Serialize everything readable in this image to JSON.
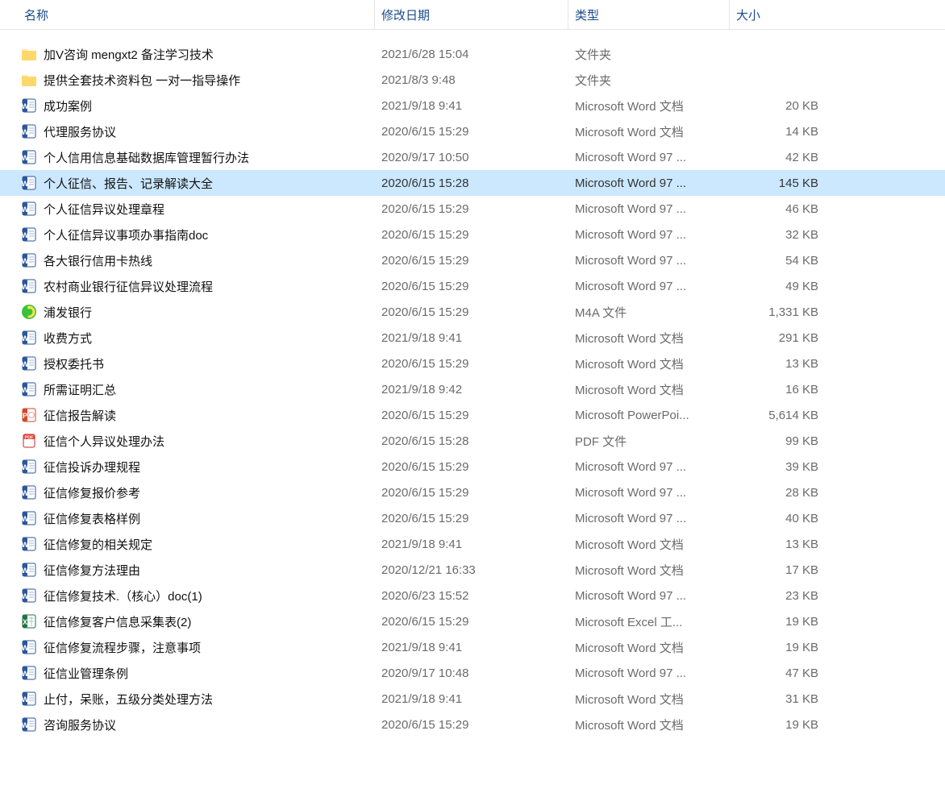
{
  "columns": {
    "name": "名称",
    "date": "修改日期",
    "type": "类型",
    "size": "大小"
  },
  "sort_indicator": "ˇ",
  "selected_index": 5,
  "files": [
    {
      "icon": "folder",
      "name": "加V咨询   mengxt2  备注学习技术",
      "date": "2021/6/28 15:04",
      "type": "文件夹",
      "size": ""
    },
    {
      "icon": "folder",
      "name": "提供全套技术资料包 一对一指导操作",
      "date": "2021/8/3 9:48",
      "type": "文件夹",
      "size": ""
    },
    {
      "icon": "word",
      "name": "成功案例",
      "date": "2021/9/18 9:41",
      "type": "Microsoft Word 文档",
      "size": "20 KB"
    },
    {
      "icon": "word",
      "name": "代理服务协议",
      "date": "2020/6/15 15:29",
      "type": "Microsoft Word 文档",
      "size": "14 KB"
    },
    {
      "icon": "word",
      "name": "个人信用信息基础数据库管理暂行办法",
      "date": "2020/9/17 10:50",
      "type": "Microsoft Word 97 ...",
      "size": "42 KB"
    },
    {
      "icon": "word",
      "name": "个人征信、报告、记录解读大全",
      "date": "2020/6/15 15:28",
      "type": "Microsoft Word 97 ...",
      "size": "145 KB"
    },
    {
      "icon": "word",
      "name": "个人征信异议处理章程",
      "date": "2020/6/15 15:29",
      "type": "Microsoft Word 97 ...",
      "size": "46 KB"
    },
    {
      "icon": "word",
      "name": "个人征信异议事项办事指南doc",
      "date": "2020/6/15 15:29",
      "type": "Microsoft Word 97 ...",
      "size": "32 KB"
    },
    {
      "icon": "word",
      "name": "各大银行信用卡热线",
      "date": "2020/6/15 15:29",
      "type": "Microsoft Word 97 ...",
      "size": "54 KB"
    },
    {
      "icon": "word",
      "name": "农村商业银行征信异议处理流程",
      "date": "2020/6/15 15:29",
      "type": "Microsoft Word 97 ...",
      "size": "49 KB"
    },
    {
      "icon": "audio",
      "name": "浦发银行",
      "date": "2020/6/15 15:29",
      "type": "M4A 文件",
      "size": "1,331 KB"
    },
    {
      "icon": "word",
      "name": "收费方式",
      "date": "2021/9/18 9:41",
      "type": "Microsoft Word 文档",
      "size": "291 KB"
    },
    {
      "icon": "word",
      "name": "授权委托书",
      "date": "2020/6/15 15:29",
      "type": "Microsoft Word 文档",
      "size": "13 KB"
    },
    {
      "icon": "word",
      "name": "所需证明汇总",
      "date": "2021/9/18 9:42",
      "type": "Microsoft Word 文档",
      "size": "16 KB"
    },
    {
      "icon": "ppt",
      "name": "征信报告解读",
      "date": "2020/6/15 15:29",
      "type": "Microsoft PowerPoi...",
      "size": "5,614 KB"
    },
    {
      "icon": "pdf",
      "name": "征信个人异议处理办法",
      "date": "2020/6/15 15:28",
      "type": "PDF 文件",
      "size": "99 KB"
    },
    {
      "icon": "word",
      "name": "征信投诉办理规程",
      "date": "2020/6/15 15:29",
      "type": "Microsoft Word 97 ...",
      "size": "39 KB"
    },
    {
      "icon": "word",
      "name": "征信修复报价参考",
      "date": "2020/6/15 15:29",
      "type": "Microsoft Word 97 ...",
      "size": "28 KB"
    },
    {
      "icon": "word",
      "name": "征信修复表格样例",
      "date": "2020/6/15 15:29",
      "type": "Microsoft Word 97 ...",
      "size": "40 KB"
    },
    {
      "icon": "word",
      "name": "征信修复的相关规定",
      "date": "2021/9/18 9:41",
      "type": "Microsoft Word 文档",
      "size": "13 KB"
    },
    {
      "icon": "word",
      "name": "征信修复方法理由",
      "date": "2020/12/21 16:33",
      "type": "Microsoft Word 文档",
      "size": "17 KB"
    },
    {
      "icon": "word",
      "name": "征信修复技术.（核心）doc(1)",
      "date": "2020/6/23 15:52",
      "type": "Microsoft Word 97 ...",
      "size": "23 KB"
    },
    {
      "icon": "excel",
      "name": "征信修复客户信息采集表(2)",
      "date": "2020/6/15 15:29",
      "type": "Microsoft Excel 工...",
      "size": "19 KB"
    },
    {
      "icon": "word",
      "name": "征信修复流程步骤，注意事项",
      "date": "2021/9/18 9:41",
      "type": "Microsoft Word 文档",
      "size": "19 KB"
    },
    {
      "icon": "word",
      "name": "征信业管理条例",
      "date": "2020/9/17 10:48",
      "type": "Microsoft Word 97 ...",
      "size": "47 KB"
    },
    {
      "icon": "word",
      "name": "止付，呆账，五级分类处理方法",
      "date": "2021/9/18 9:41",
      "type": "Microsoft Word 文档",
      "size": "31 KB"
    },
    {
      "icon": "word",
      "name": "咨询服务协议",
      "date": "2020/6/15 15:29",
      "type": "Microsoft Word 文档",
      "size": "19 KB"
    }
  ]
}
